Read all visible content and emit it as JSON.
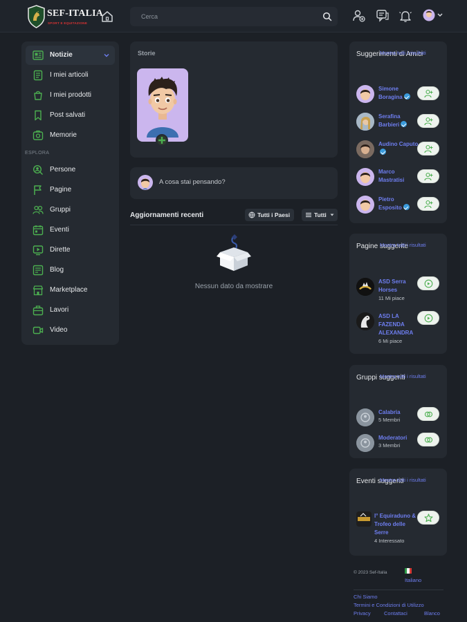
{
  "header": {
    "logo_title": "SEF-ITALIA",
    "logo_subtitle": "SPORT E EQUITAZIONE",
    "search_placeholder": "Cerca"
  },
  "colors": {
    "background": "#1c2026",
    "card": "#252a31",
    "accent_green": "#4caf50",
    "link_blue": "#6e7ef0"
  },
  "icons": {
    "home": "home-icon",
    "search": "search-icon",
    "friends": "person-add-icon",
    "messages": "chat-icon",
    "notifications": "bell-icon",
    "avatar": "avatar-icon"
  },
  "nav": {
    "items": [
      {
        "label": "Notizie",
        "icon": "newspaper-icon",
        "active": true
      },
      {
        "label": "I miei articoli",
        "icon": "document-icon"
      },
      {
        "label": "I miei prodotti",
        "icon": "box-icon"
      },
      {
        "label": "Post salvati",
        "icon": "bookmark-icon"
      },
      {
        "label": "Memorie",
        "icon": "memories-icon"
      }
    ],
    "section_label": "ESPLORA",
    "explore": [
      {
        "label": "Persone",
        "icon": "people-search-icon"
      },
      {
        "label": "Pagine",
        "icon": "flag-icon"
      },
      {
        "label": "Gruppi",
        "icon": "group-icon"
      },
      {
        "label": "Eventi",
        "icon": "calendar-icon"
      },
      {
        "label": "Dirette",
        "icon": "live-icon"
      },
      {
        "label": "Blog",
        "icon": "blog-icon"
      },
      {
        "label": "Marketplace",
        "icon": "store-icon"
      },
      {
        "label": "Lavori",
        "icon": "briefcase-icon"
      },
      {
        "label": "Video",
        "icon": "video-icon"
      }
    ]
  },
  "stories": {
    "title": "Storie"
  },
  "composer": {
    "placeholder": "A cosa stai pensando?"
  },
  "updates": {
    "title": "Aggiornamenti recenti",
    "filter_country": "Tutti i Paesi",
    "filter_type": "Tutti",
    "empty_text": "Nessun dato da mostrare"
  },
  "friends": {
    "title": "Suggerimenti di Amici",
    "show_all": "Mostra tutti i risultati",
    "people": [
      {
        "name": "Simone Boragina",
        "verified": true
      },
      {
        "name": "Serafina Barbieri",
        "verified": true
      },
      {
        "name": "Audino Caputo",
        "verified": true
      },
      {
        "name": "Marco Mastratisi",
        "verified": false
      },
      {
        "name": "Pietro Esposito",
        "verified": true
      }
    ]
  },
  "pages": {
    "title": "Pagine suggerite",
    "show_all": "Mostra tutti i risultati",
    "items": [
      {
        "name": "ASD Serra Horses",
        "meta": "11 Mi piace"
      },
      {
        "name": "ASD LA FAZENDA ALEXANDRA",
        "meta": "6 Mi piace"
      }
    ]
  },
  "groups": {
    "title": "Gruppi suggeriti",
    "show_all": "Mostra tutti i risultati",
    "items": [
      {
        "name": "Calabria",
        "meta": "5 Membri"
      },
      {
        "name": "Moderatori",
        "meta": "3 Membri"
      }
    ]
  },
  "events": {
    "title": "Eventi suggeriti",
    "show_all": "Mostra tutti i risultati",
    "items": [
      {
        "name": "I° Equiraduno & Trofeo delle Serre",
        "meta": "4 Interessato"
      }
    ]
  },
  "footer": {
    "copyright": "© 2023 Sef-Italia",
    "language": "Italiano",
    "links": [
      "Chi Siamo",
      "Termini e Condizioni di Utilizzo",
      "Privacy",
      "Contattaci",
      "Blanco"
    ]
  }
}
